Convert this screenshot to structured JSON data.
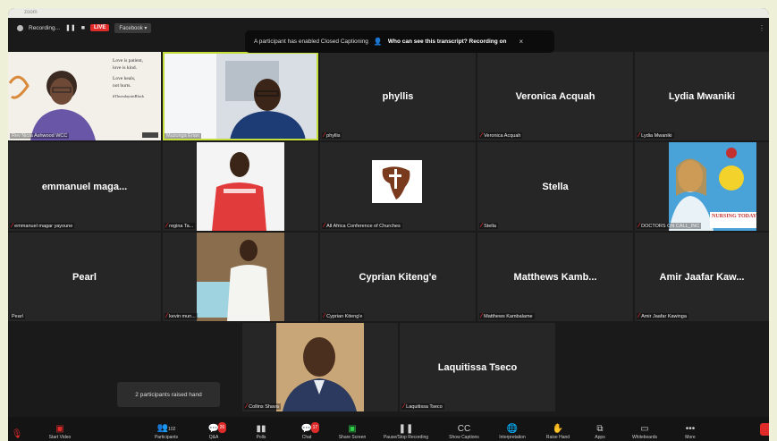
{
  "window": {
    "title": "zoom"
  },
  "topbar": {
    "recording": "Recording...",
    "live": "LIVE",
    "stream_target": "Facebook ▾"
  },
  "banner": {
    "text": "A participant has enabled Closed Captioning",
    "question": "Who can see this transcript? Recording on",
    "close": "×"
  },
  "tiles": {
    "t1": {
      "label": "Rev Nicta Ashwood WCC",
      "slide_lines": [
        "Love is patient,",
        "love is kind.",
        "Love heals,",
        "not hurts.",
        "#ThursdaysinBlack"
      ]
    },
    "t2": {
      "label": "Muzunga Erian"
    },
    "t3": {
      "name": "phyllis",
      "label": "phyllis"
    },
    "t4": {
      "name": "Veronica Acquah",
      "label": "Veronica Acquah"
    },
    "t5": {
      "name": "Lydia Mwaniki",
      "label": "Lydia Mwaniki"
    },
    "t6": {
      "name": "emmanuel maga...",
      "label": "emmanuel magar yayoune"
    },
    "t7": {
      "label": "regina Ta..."
    },
    "t8": {
      "label": "All Africa Conference of Churches"
    },
    "t9": {
      "name": "Stella",
      "label": "Stella"
    },
    "t10": {
      "label": "DOCTORS ON CALL_INC",
      "image_text": "NURSING TODAY"
    },
    "t11": {
      "name": "Pearl",
      "label": "Pearl"
    },
    "t12": {
      "label": "kevin mun..."
    },
    "t13": {
      "name": "Cyprian Kiteng'e",
      "label": "Cyprian Kiteng'e"
    },
    "t14": {
      "name": "Matthews Kamb...",
      "label": "Matthews Kambalame"
    },
    "t15": {
      "name": "Amir Jaafar Kaw...",
      "label": "Amir Jaafar Kawinga"
    },
    "t16": {
      "label": "Collins Shava"
    },
    "t17": {
      "name": "Laquitissa Tseco",
      "label": "Laquitissa Tseco"
    }
  },
  "popup": {
    "hands": "2 participants raised hand"
  },
  "toolbar": {
    "start_video": "Start Video",
    "participants": "Participants",
    "participants_count": "102",
    "qa": "Q&A",
    "qa_badge": "26",
    "polls": "Polls",
    "chat": "Chat",
    "chat_badge": "17",
    "share_screen": "Share Screen",
    "pause_recording": "Pause/Stop Recording",
    "show_captions": "Show Captions",
    "interpretation": "Interpretation",
    "raise_hand": "Raise Hand",
    "apps": "Apps",
    "whiteboards": "Whiteboards",
    "more": "More"
  },
  "colors": {
    "active_speaker": "#c5dd3b",
    "live": "#e02b2b",
    "share": "#2fcf4a"
  }
}
